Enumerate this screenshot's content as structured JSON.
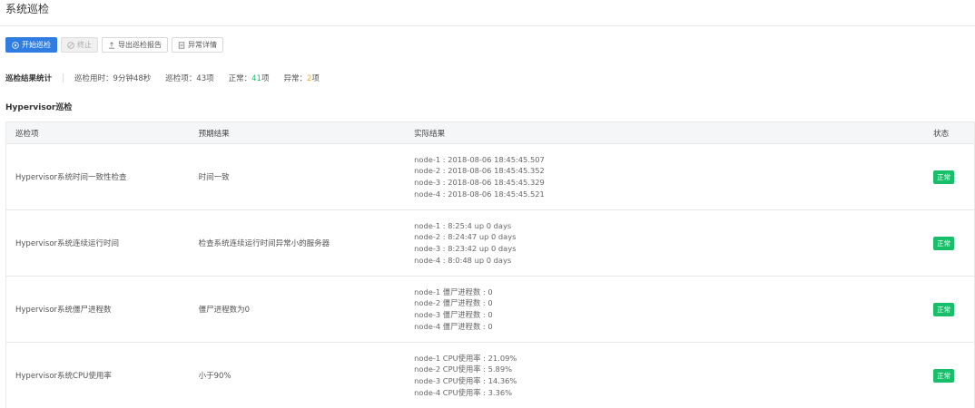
{
  "page": {
    "title": "系统巡检"
  },
  "toolbar": {
    "start_label": "开始巡检",
    "stop_label": "终止",
    "export_label": "导出巡检报告",
    "detail_label": "异常详情"
  },
  "stats": {
    "heading": "巡检结果统计",
    "duration_label": "巡检用时：",
    "duration_value": "9分钟48秒",
    "items_label": "巡检项：",
    "items_value": "43项",
    "normal_label": "正常：",
    "normal_count": "41",
    "normal_unit": "项",
    "abnormal_label": "异常：",
    "abnormal_count": "2",
    "abnormal_unit": "项",
    "colors": {
      "normal": "#19be6b",
      "abnormal": "#f5a623"
    }
  },
  "section": {
    "title": "Hypervisor巡检"
  },
  "table": {
    "headers": [
      "巡检项",
      "预期结果",
      "实际结果",
      "状态"
    ],
    "rows": [
      {
        "item": "Hypervisor系统时间一致性检查",
        "expected": "时间一致",
        "actual": [
          "node-1 : 2018-08-06 18:45:45.507",
          "node-2 : 2018-08-06 18:45:45.352",
          "node-3 : 2018-08-06 18:45:45.329",
          "node-4 : 2018-08-06 18:45:45.521"
        ],
        "status": "正常"
      },
      {
        "item": "Hypervisor系统连续运行时间",
        "expected": "检查系统连续运行时间异常小的服务器",
        "actual": [
          "node-1 : 8:25:4 up 0 days",
          "node-2 : 8:24:47 up 0 days",
          "node-3 : 8:23:42 up 0 days",
          "node-4 : 8:0:48 up 0 days"
        ],
        "status": "正常"
      },
      {
        "item": "Hypervisor系统僵尸进程数",
        "expected": "僵尸进程数为0",
        "actual": [
          "node-1 僵尸进程数 : 0",
          "node-2 僵尸进程数 : 0",
          "node-3 僵尸进程数 : 0",
          "node-4 僵尸进程数 : 0"
        ],
        "status": "正常"
      },
      {
        "item": "Hypervisor系统CPU使用率",
        "expected": "小于90%",
        "actual": [
          "node-1 CPU使用率 : 21.09%",
          "node-2 CPU使用率 : 5.89%",
          "node-3 CPU使用率 : 14.36%",
          "node-4 CPU使用率 : 3.36%"
        ],
        "status": "正常"
      }
    ]
  }
}
